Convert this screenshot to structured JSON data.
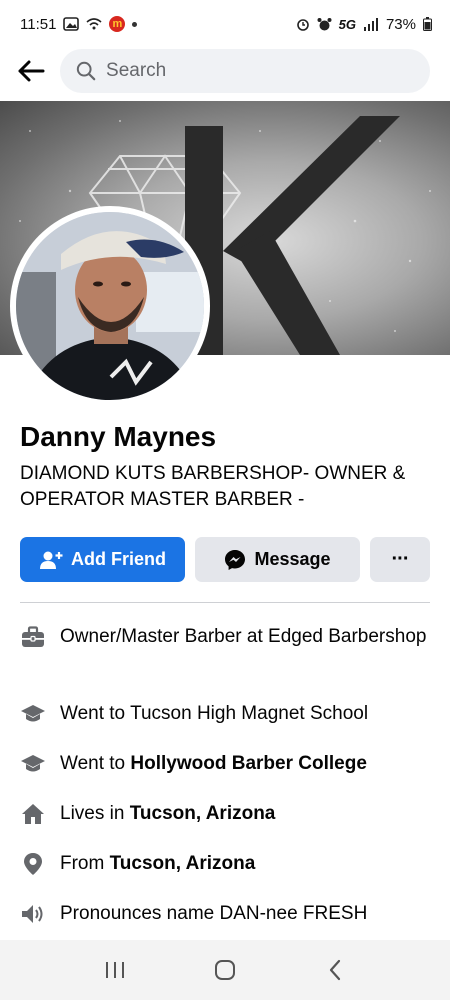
{
  "status_bar": {
    "time": "11:51",
    "network": "5G",
    "battery": "73%",
    "icons": [
      "gallery-icon",
      "wifi-icon",
      "mcdonalds-app-icon",
      "notification-dot-icon",
      "alarm-icon",
      "alarm-clock-icon",
      "signal-icon",
      "battery-icon"
    ]
  },
  "topnav": {
    "back_icon": "arrow-left-icon",
    "search_placeholder": "Search"
  },
  "profile": {
    "name": "Danny Maynes",
    "bio": "DIAMOND KUTS BARBERSHOP- OWNER & OPERATOR MASTER BARBER -"
  },
  "actions": {
    "add_friend": "Add Friend",
    "message": "Message",
    "more": "···"
  },
  "details": {
    "work": "Owner/Master Barber at Edged Barbershop",
    "school1": "Went to Tucson High Magnet School",
    "school2_prefix": "Went to ",
    "school2_bold": "Hollywood Barber College",
    "lives_prefix": "Lives in ",
    "lives_bold": "Tucson, Arizona",
    "from_prefix": "From ",
    "from_bold": "Tucson, Arizona",
    "pronounce": "Pronounces name DAN-nee FRESH"
  },
  "colors": {
    "primary": "#1b74e4",
    "secondary_bg": "#e4e6eb",
    "icon_gray": "#65676b"
  }
}
